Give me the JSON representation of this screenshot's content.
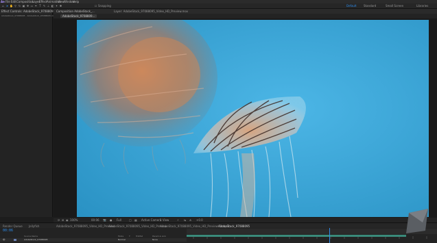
{
  "menu": [
    "Ae",
    "File",
    "Edit",
    "Composition",
    "Layer",
    "Effect",
    "Animation",
    "View",
    "Window",
    "Help"
  ],
  "toolbar": {
    "snapping_label": "Snapping",
    "workspaces": [
      "Default",
      "Standard",
      "Small Screen",
      "Libraries"
    ],
    "active_workspace": "Default"
  },
  "project_panel": {
    "tab_label": "Effect Controls: AdobeStock_97088095.mov",
    "subtitle": "AdobeStock_97088095 · AdobeStock_97088095.mov"
  },
  "composition": {
    "header_tabs": [
      "Composition AdobeStock_...",
      "Layer: AdobeStock_97088095_Video_HD_Preview.mov"
    ],
    "active_subtab": "AdobeStock_9708809..."
  },
  "viewer_controls": {
    "zoom": "100%",
    "resolution": "Full",
    "camera": "Active Camera",
    "views": "1 View",
    "exposure": "+0.0"
  },
  "timeline": {
    "tabs": [
      "Render Queue",
      "Jellyfish",
      "AdobeStock_97088095_Video_HD_Preview",
      "AdobeStock_97088095_Video_HD_Preview",
      "AdobeStock_97088095_Video_HD_Preview Comp 1",
      "AdobeStock_97088095"
    ],
    "active_tab": "AdobeStock_97088095",
    "timecode": "00:06",
    "columns": [
      "Source Name",
      "Mode",
      "T",
      "TrkMat",
      "Parent & Link"
    ],
    "layer_mode": "Normal",
    "layer_parent": "None"
  },
  "colors": {
    "accent": "#2d8ceb",
    "panel": "#232323",
    "background": "#1d1d1d",
    "water": "#3aa3d0"
  }
}
